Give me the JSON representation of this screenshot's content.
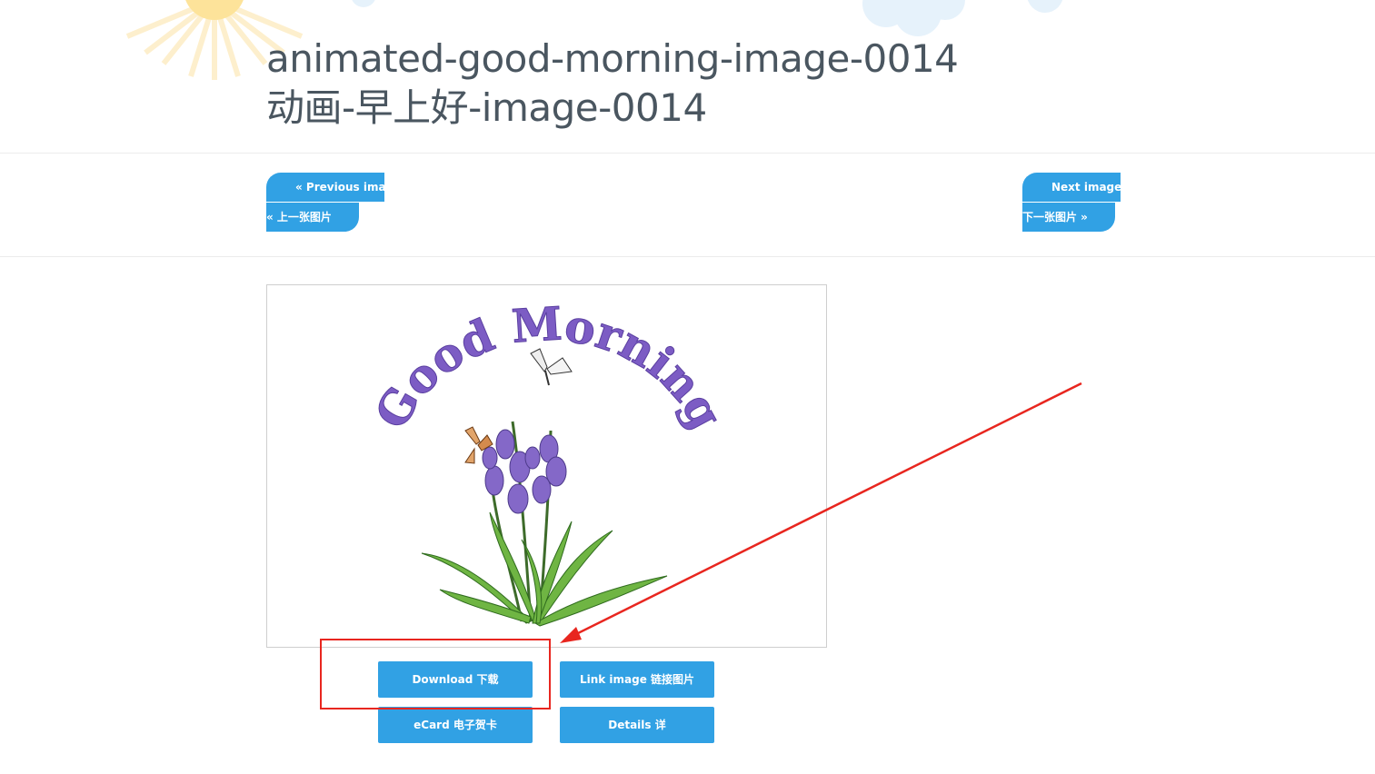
{
  "title": {
    "line1": "animated-good-morning-image-0014",
    "line2": "动画-早上好-image-0014"
  },
  "nav": {
    "previous_line1": "« Previous image",
    "previous_line2": "« 上一张图片",
    "next_line1": "Next image »",
    "next_line2": "下一张图片 »"
  },
  "image": {
    "caption_text": "Good Morning"
  },
  "actions": {
    "download": "Download 下载",
    "link_image": "Link image 链接图片",
    "ecard": "eCard 电子贺卡",
    "details": "Details 详"
  },
  "colors": {
    "button": "#31a1e4",
    "title": "#4a5660",
    "annotation": "#e8261f",
    "caption": "#7c5cc4"
  }
}
